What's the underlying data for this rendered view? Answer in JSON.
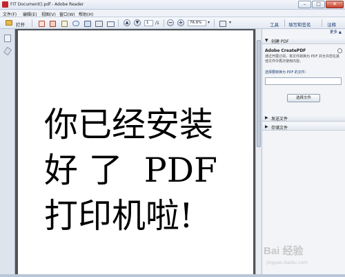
{
  "window": {
    "title": "FIT Document().pdf - Adobe Reader",
    "minimize_glyph": "–",
    "maximize_glyph": "□",
    "close_glyph": "✕"
  },
  "menubar": {
    "items": [
      "文件(F)",
      "编辑(E)",
      "视图(V)",
      "窗口(W)",
      "帮助(H)"
    ]
  },
  "toolbar": {
    "open_label": "打开",
    "page_current": "1",
    "page_total": "/1",
    "zoom_value": "76.6%",
    "zoom_out_glyph": "−",
    "zoom_in_glyph": "+",
    "tabs": [
      "工具",
      "填写和签名",
      "注释"
    ]
  },
  "document": {
    "lines": [
      "你已经安装",
      "好 了  PDF",
      "打印机啦!"
    ]
  },
  "panel": {
    "collapse_link": "更多 ▲",
    "create_pdf_header": "创建 PDF",
    "service_name": "Adobe CreatePDF",
    "description": "通过开展订阅，将文件转换为 PDF 并允许您在其他文件中再次使用内容。",
    "select_label": "选择要转换为 PDF 的文件：",
    "select_button": "选择文件",
    "send_files_header": "发送文件",
    "store_files_header": "存储文件"
  },
  "watermark": {
    "logo": "Bai 经验",
    "url": "jingyan.baidu.com"
  },
  "colors": {
    "accent": "#1d3a73",
    "doc_background": "#4f5257",
    "panel_background": "#f2f4f7"
  }
}
